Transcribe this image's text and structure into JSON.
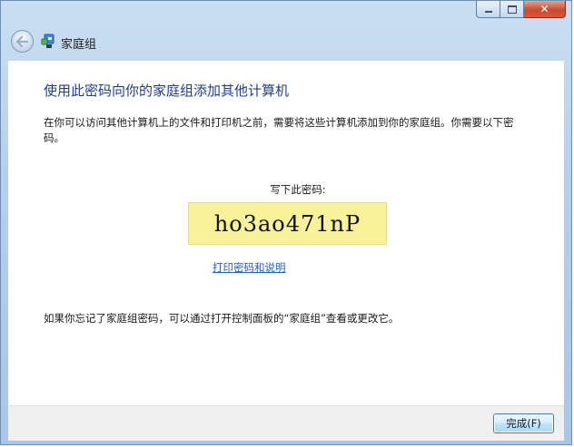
{
  "window": {
    "title": "",
    "controls": {
      "minimize": "minimize",
      "maximize": "maximize",
      "close": "close"
    }
  },
  "navbar": {
    "title": "家庭组"
  },
  "main": {
    "heading": "使用此密码向你的家庭组添加其他计算机",
    "description": "在你可以访问其他计算机上的文件和打印机之前，需要将这些计算机添加到你的家庭组。你需要以下密码。",
    "password_label": "写下此密码:",
    "password": "ho3ao471nP",
    "print_link": "打印密码和说明",
    "footer_note": "如果你忘记了家庭组密码，可以通过打开控制面板的“家庭组”查看或更改它。"
  },
  "footer": {
    "finish_label": "完成(F)"
  },
  "colors": {
    "heading": "#1e3e8c",
    "link": "#1f5fbf",
    "password_bg": "#f9f29b",
    "chrome": "#b6d0ea"
  }
}
